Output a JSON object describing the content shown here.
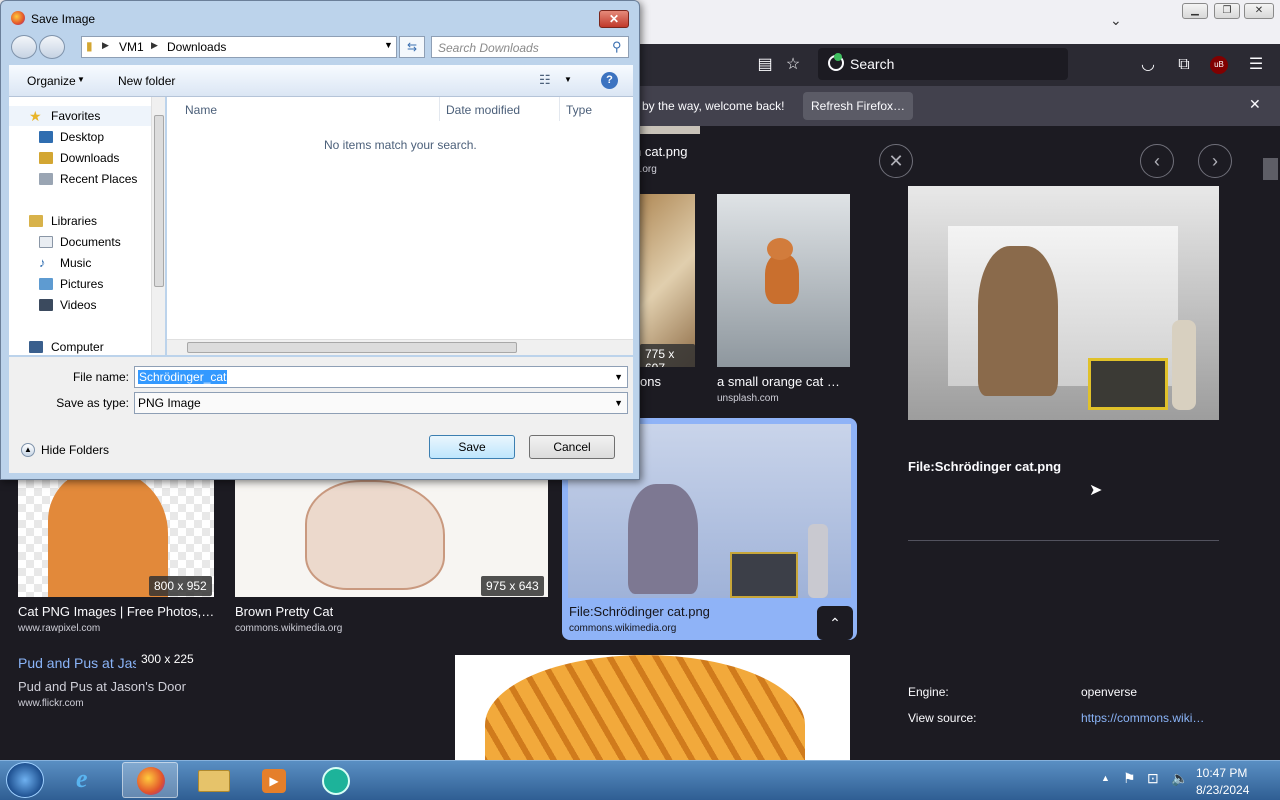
{
  "browser": {
    "search_label": "Search",
    "notification_text": "by the way, welcome back!",
    "refresh_button": "Refresh Firefox…",
    "extension_badge": "uB"
  },
  "results": [
    {
      "caption": "n cat.png",
      "source": "a.org"
    },
    {
      "dimensions": "775 x 607",
      "caption": "ons"
    },
    {
      "caption": "a small orange cat …",
      "source": "unsplash.com"
    },
    {
      "dimensions": "800 x 952",
      "caption": "Cat PNG Images | Free Photos,…",
      "source": "www.rawpixel.com"
    },
    {
      "dimensions": "975 x 643",
      "caption": "Brown Pretty Cat",
      "source": "commons.wikimedia.org"
    },
    {
      "caption": "File:Schrödinger cat.png",
      "source": "commons.wikimedia.org"
    },
    {
      "dimensions": "300 x 225",
      "link": "Pud and Pus at Jason's Door",
      "caption": "Pud and Pus at Jason's Door",
      "source": "www.flickr.com"
    }
  ],
  "detail": {
    "title": "File:Schrödinger cat.png",
    "engine_label": "Engine:",
    "engine_value": "openverse",
    "source_label": "View source:",
    "source_value": "https://commons.wiki…"
  },
  "dialog": {
    "title": "Save Image",
    "breadcrumb": [
      "VM1",
      "Downloads"
    ],
    "search_placeholder": "Search Downloads",
    "organize": "Organize",
    "new_folder": "New folder",
    "nav": {
      "favorites": "Favorites",
      "desktop": "Desktop",
      "downloads": "Downloads",
      "recent": "Recent Places",
      "libraries": "Libraries",
      "documents": "Documents",
      "music": "Music",
      "pictures": "Pictures",
      "videos": "Videos",
      "computer": "Computer"
    },
    "columns": {
      "name": "Name",
      "date": "Date modified",
      "type": "Type"
    },
    "empty_message": "No items match your search.",
    "file_name_label": "File name:",
    "file_name_value": "Schrödinger_cat",
    "save_type_label": "Save as type:",
    "save_type_value": "PNG Image",
    "hide_folders": "Hide Folders",
    "save_button": "Save",
    "cancel_button": "Cancel"
  },
  "taskbar": {
    "time": "10:47 PM",
    "date": "8/23/2024"
  }
}
